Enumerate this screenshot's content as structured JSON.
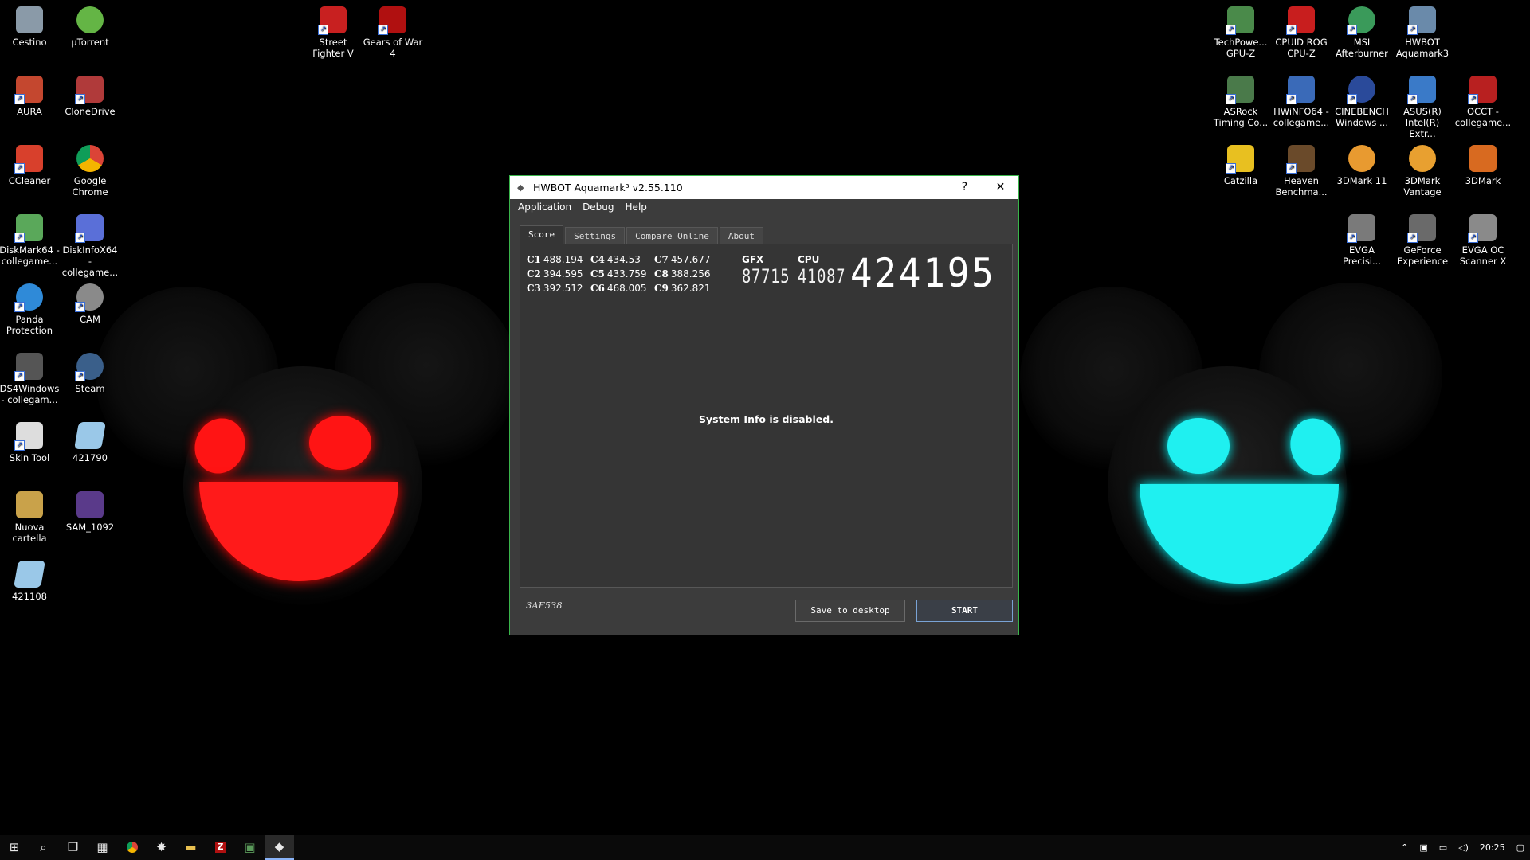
{
  "desktop_icons": [
    {
      "name": "recycle-bin-icon",
      "label": "Cestino",
      "color": "#8a9aa8"
    },
    {
      "name": "utorrent-icon",
      "label": "µTorrent",
      "color": "#64b545"
    },
    {
      "name": "aura-icon",
      "label": "AURA",
      "color": "#c4472f"
    },
    {
      "name": "clonedrive-icon",
      "label": "CloneDrive",
      "color": "#b03a3a"
    },
    {
      "name": "ccleaner-icon",
      "label": "CCleaner",
      "color": "#d8402c"
    },
    {
      "name": "chrome-icon",
      "label": "Google Chrome",
      "color": "#e8b030"
    },
    {
      "name": "diskmark-icon",
      "label": "DiskMark64 - collegame...",
      "color": "#5aa85a"
    },
    {
      "name": "diskinfo-icon",
      "label": "DiskInfoX64 - collegame...",
      "color": "#5a6fd8"
    },
    {
      "name": "panda-icon",
      "label": "Panda Protection",
      "color": "#2f8ad8"
    },
    {
      "name": "cam-icon",
      "label": "CAM",
      "color": "#8a8a8a"
    },
    {
      "name": "ds4windows-icon",
      "label": "DS4Windows - collegam...",
      "color": "#555"
    },
    {
      "name": "steam-icon",
      "label": "Steam",
      "color": "#3a5f8a"
    },
    {
      "name": "skin-tool-icon",
      "label": "Skin Tool",
      "color": "#ddd"
    },
    {
      "name": "file-421790-icon",
      "label": "421790",
      "color": "#9ac8e8"
    },
    {
      "name": "nuova-cartella-icon",
      "label": "Nuova cartella",
      "color": "#c9a24a"
    },
    {
      "name": "sam-1092-icon",
      "label": "SAM_1092",
      "color": "#5a3a8a"
    },
    {
      "name": "file-421108-icon",
      "label": "421108",
      "color": "#9ac8e8"
    },
    {
      "name": "street-fighter-icon",
      "label": "Street Fighter V",
      "color": "#c82020"
    },
    {
      "name": "gears-of-war-icon",
      "label": "Gears of War 4",
      "color": "#b01010"
    },
    {
      "name": "gpuz-icon",
      "label": "TechPowe... GPU-Z",
      "color": "#4a8a4a"
    },
    {
      "name": "cpuz-icon",
      "label": "CPUID ROG CPU-Z",
      "color": "#c81e1e"
    },
    {
      "name": "afterburner-icon",
      "label": "MSI Afterburner",
      "color": "#3a9a5a"
    },
    {
      "name": "aquamark-icon",
      "label": "HWBOT Aquamark3",
      "color": "#6a8aaa"
    },
    {
      "name": "asrock-timing-icon",
      "label": "ASRock Timing Co...",
      "color": "#4a7a4a"
    },
    {
      "name": "hwinfo-icon",
      "label": "HWiNFO64 - collegame...",
      "color": "#3a6ab8"
    },
    {
      "name": "cinebench-icon",
      "label": "CINEBENCH Windows ...",
      "color": "#2a4a9a"
    },
    {
      "name": "asus-xtu-icon",
      "label": "ASUS(R) Intel(R) Extr...",
      "color": "#3a7ac8"
    },
    {
      "name": "occt-icon",
      "label": "OCCT - collegame...",
      "color": "#b82020"
    },
    {
      "name": "catzilla-icon",
      "label": "Catzilla",
      "color": "#e8c020"
    },
    {
      "name": "heaven-icon",
      "label": "Heaven Benchma...",
      "color": "#6a4a2a"
    },
    {
      "name": "3dmark11-icon",
      "label": "3DMark 11",
      "color": "#e89a30"
    },
    {
      "name": "3dmark-vantage-icon",
      "label": "3DMark Vantage",
      "color": "#e8a030"
    },
    {
      "name": "3dmark-icon",
      "label": "3DMark",
      "color": "#d86a20"
    },
    {
      "name": "evga-precision-icon",
      "label": "EVGA Precisi...",
      "color": "#7a7a7a"
    },
    {
      "name": "geforce-experience-icon",
      "label": "GeForce Experience",
      "color": "#6a6a6a"
    },
    {
      "name": "evga-oc-scanner-icon",
      "label": "EVGA OC Scanner X",
      "color": "#8a8a8a"
    }
  ],
  "window": {
    "title": "HWBOT Aquamark³ v2.55.110",
    "help_btn": "?",
    "close_btn": "✕",
    "menu": [
      "Application",
      "Debug",
      "Help"
    ],
    "tabs": [
      "Score",
      "Settings",
      "Compare Online",
      "About"
    ],
    "scores": [
      {
        "k": "C1",
        "v": "488.194"
      },
      {
        "k": "C4",
        "v": "434.53"
      },
      {
        "k": "C7",
        "v": "457.677"
      },
      {
        "k": "C2",
        "v": "394.595"
      },
      {
        "k": "C5",
        "v": "433.759"
      },
      {
        "k": "C8",
        "v": "388.256"
      },
      {
        "k": "C3",
        "v": "392.512"
      },
      {
        "k": "C6",
        "v": "468.005"
      },
      {
        "k": "C9",
        "v": "362.821"
      }
    ],
    "gfx_label": "GFX",
    "gfx_value": "87715",
    "cpu_label": "CPU",
    "cpu_value": "41087",
    "total": "424195",
    "system_info": "System Info is disabled.",
    "code": "3AF538",
    "save_btn": "Save to desktop",
    "start_btn": "START"
  },
  "taskbar": {
    "items": [
      "start-windows-icon",
      "search-icon",
      "task-view-icon",
      "calculator-icon",
      "chrome-icon",
      "app-icon",
      "file-explorer-icon",
      "filezilla-icon",
      "app-green-icon",
      "aquamark-task-icon"
    ],
    "time": "20:25"
  }
}
